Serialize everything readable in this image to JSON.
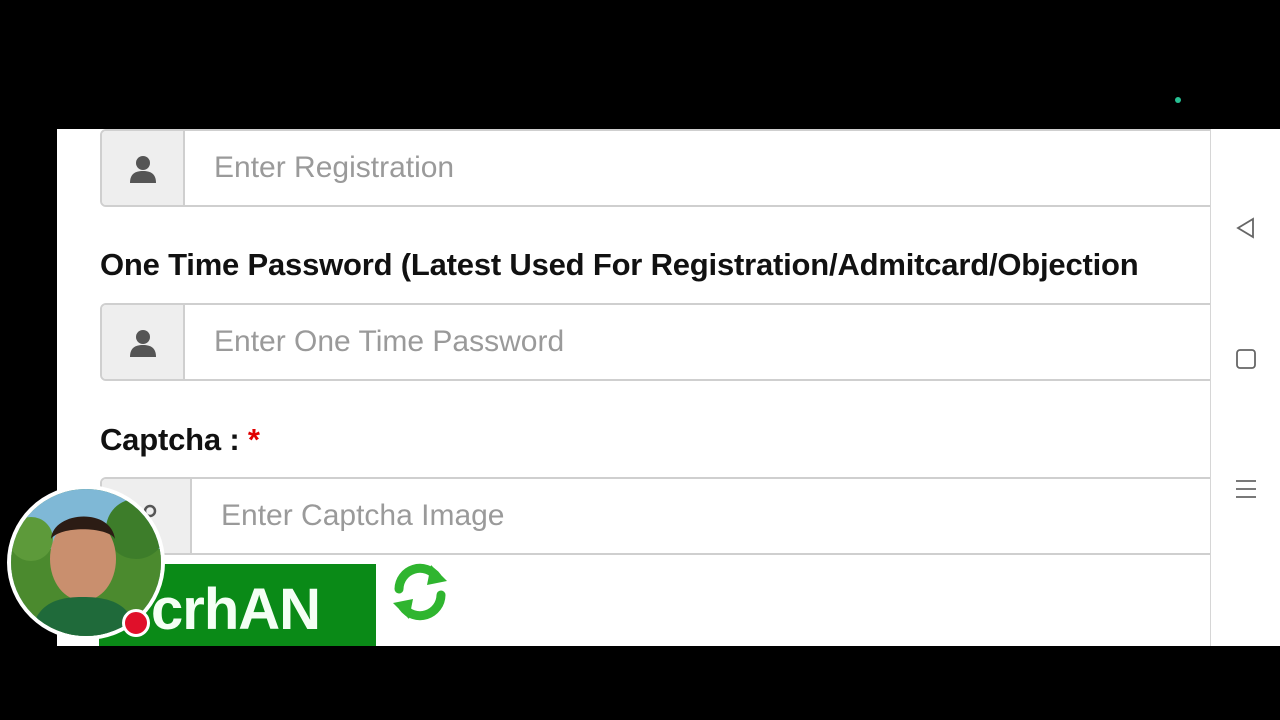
{
  "form": {
    "registration": {
      "placeholder": "Enter Registration",
      "icon": "user-icon"
    },
    "otp": {
      "label": "One Time Password (Latest Used For Registration/Admitcard/Objection",
      "placeholder": "Enter One Time Password",
      "icon": "user-icon"
    },
    "captcha": {
      "label": "Captcha :",
      "required_mark": "*",
      "placeholder": "Enter Captcha Image",
      "image_text": "crhAN",
      "refresh_icon": "refresh-icon"
    }
  },
  "nav": {
    "buttons": [
      {
        "icon": "back-triangle-icon"
      },
      {
        "icon": "home-square-icon"
      },
      {
        "icon": "menu-lines-icon"
      }
    ]
  },
  "colors": {
    "captcha_bg": "#0a8a17",
    "required": "#e00000",
    "refresh": "#2fb52f",
    "rec_dot": "#e0102a",
    "status_dot": "#27c093"
  }
}
